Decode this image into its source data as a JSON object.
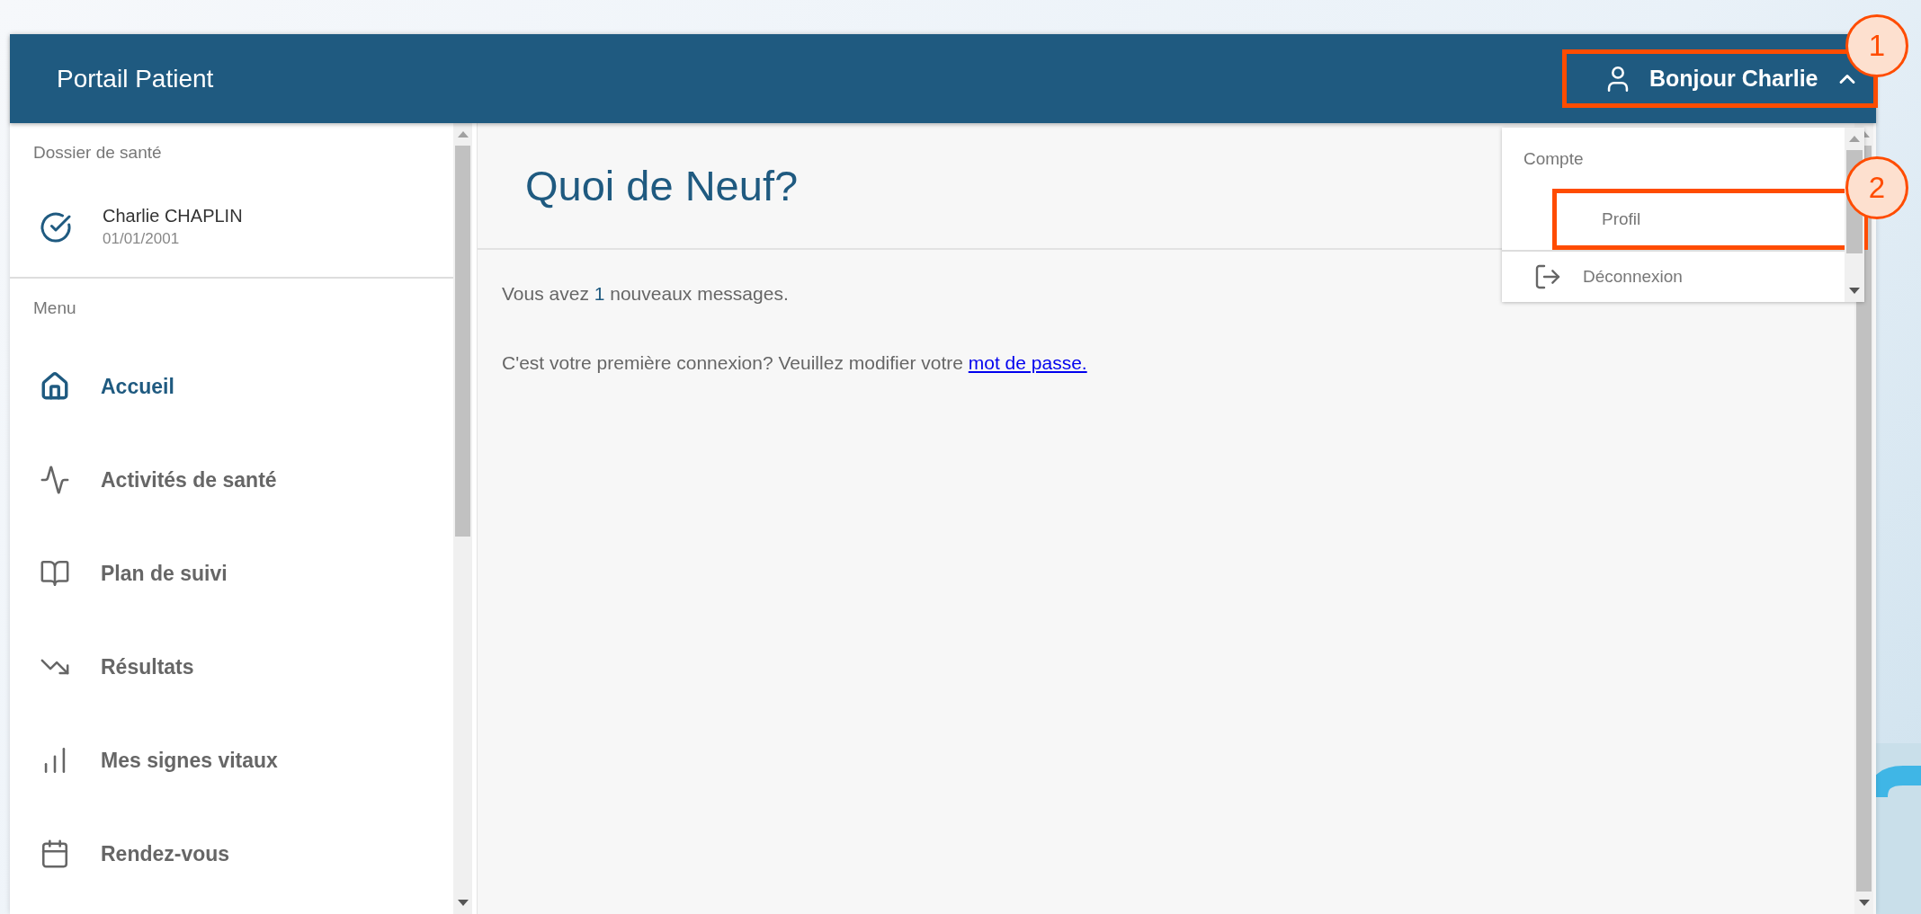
{
  "header": {
    "title": "Portail Patient",
    "user_menu": {
      "label": "Bonjour Charlie",
      "expanded": true,
      "highlighted": true
    }
  },
  "sidebar": {
    "record_heading": "Dossier de santé",
    "patient": {
      "name": "Charlie CHAPLIN",
      "birth_date": "01/01/2001"
    },
    "menu_heading": "Menu",
    "items": [
      {
        "label": "Accueil",
        "selected": true
      },
      {
        "label": "Activités de santé",
        "selected": false
      },
      {
        "label": "Plan de suivi",
        "selected": false
      },
      {
        "label": "Résultats",
        "selected": false
      },
      {
        "label": "Mes signes vitaux",
        "selected": false
      },
      {
        "label": "Rendez-vous",
        "selected": false
      }
    ]
  },
  "main": {
    "title": "Quoi de Neuf?",
    "messages_notice": {
      "before": "Vous avez ",
      "count": "1",
      "after": " nouveaux messages."
    },
    "password_notice": {
      "text": "C'est votre première connexion? Veuillez modifier votre ",
      "link": "mot de passe."
    }
  },
  "account_menu": {
    "heading": "Compte",
    "items": [
      {
        "label": "Profil",
        "highlighted": true
      },
      {
        "label": "Déconnexion",
        "highlighted": false
      }
    ]
  },
  "callouts": [
    {
      "number": "1"
    },
    {
      "number": "2"
    }
  ]
}
